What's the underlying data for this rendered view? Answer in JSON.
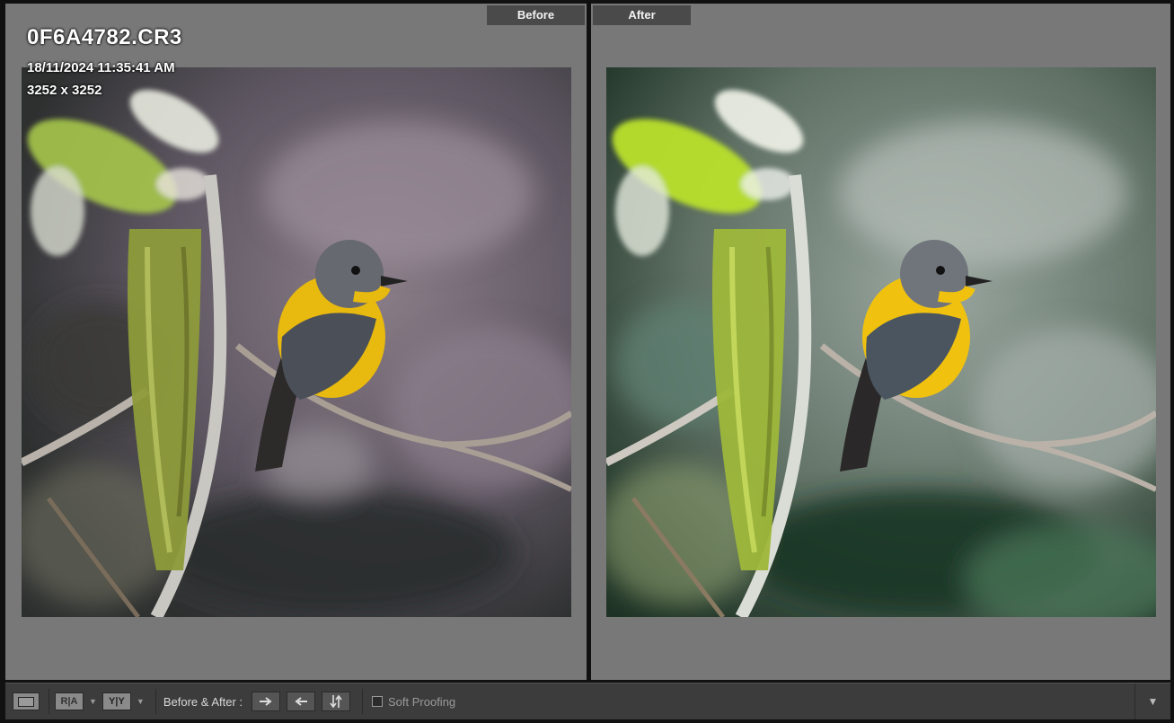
{
  "before_pane": {
    "label": "Before",
    "filename": "0F6A4782.CR3",
    "datetime": "18/11/2024 11:35:41 AM",
    "dimensions": "3252 x 3252"
  },
  "after_pane": {
    "label": "After"
  },
  "toolbar": {
    "view_single_icon": "loupe-view-icon",
    "view_ra_label": "R|A",
    "view_yy_label": "Y|Y",
    "before_after_label": "Before & After :",
    "copy_before_to_after_icon": "arrow-right-icon",
    "copy_after_to_before_icon": "arrow-left-icon",
    "swap_icon": "swap-arrows-icon",
    "soft_proofing_label": "Soft Proofing",
    "soft_proofing_checked": false,
    "toolbar_menu_icon": "chevron-down-icon"
  },
  "colors": {
    "pane_background": "#787878",
    "label_background": "#4a4a4a",
    "toolbar_background": "#3c3c3c",
    "bird_yellow": "#e8b90f",
    "bird_grey": "#4b5058"
  }
}
